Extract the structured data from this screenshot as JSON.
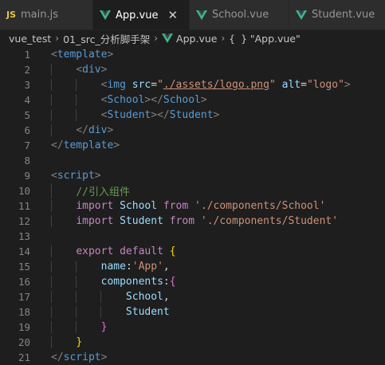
{
  "tabs": [
    {
      "label": "main.js",
      "icon": "js-icon",
      "icon_text": "JS",
      "active": false
    },
    {
      "label": "App.vue",
      "icon": "vue-icon",
      "active": true,
      "close": "✕"
    },
    {
      "label": "School.vue",
      "icon": "vue-icon",
      "active": false
    },
    {
      "label": "Student.vue",
      "icon": "vue-icon",
      "active": false
    }
  ],
  "breadcrumb": {
    "project": "vue_test",
    "folder": "01_src_分析脚手架",
    "file": "App.vue",
    "symbol_icon": "{ }",
    "symbol": "\"App.vue\""
  },
  "colors": {
    "editor_bg": "#1e1e1e",
    "tab_bg": "#2d2d2d",
    "vue_green": "#41b883",
    "js_yellow": "#e8c44a"
  },
  "code": {
    "line_numbers": [
      "1",
      "2",
      "3",
      "4",
      "5",
      "6",
      "7",
      "8",
      "9",
      "10",
      "11",
      "12",
      "13",
      "14",
      "15",
      "16",
      "17",
      "18",
      "19",
      "20",
      "21"
    ],
    "l1": {
      "open": "<",
      "tag": "template",
      "close": ">"
    },
    "l2": {
      "open": "<",
      "tag": "div",
      "close": ">"
    },
    "l3": {
      "open": "<",
      "tag": "img",
      "attr1": "src",
      "eq": "=",
      "q1": "\"",
      "val1": "./assets/logo.png",
      "attr2": "alt",
      "val2": "\"logo\"",
      "close": ">"
    },
    "l4": {
      "open": "<",
      "tag": "School",
      "mid": "></",
      "tag2": "School",
      "close": ">"
    },
    "l5": {
      "open": "<",
      "tag": "Student",
      "mid": "></",
      "tag2": "Student",
      "close": ">"
    },
    "l6": {
      "open": "</",
      "tag": "div",
      "close": ">"
    },
    "l7": {
      "open": "</",
      "tag": "template",
      "close": ">"
    },
    "l9": {
      "open": "<",
      "tag": "script",
      "close": ">"
    },
    "l10": {
      "comment": "//引入组件"
    },
    "l11": {
      "kw": "import",
      "name": "School",
      "from": "from",
      "path": "'./components/School'"
    },
    "l12": {
      "kw": "import",
      "name": "Student",
      "from": "from",
      "path": "'./components/Student'"
    },
    "l14": {
      "kw": "export",
      "kw2": "default",
      "brace": "{"
    },
    "l15": {
      "key": "name",
      "colon": ":",
      "val": "'App'",
      "comma": ","
    },
    "l16": {
      "key": "components",
      "colon": ":",
      "brace": "{"
    },
    "l17": {
      "item": "School",
      "comma": ","
    },
    "l18": {
      "item": "Student"
    },
    "l19": {
      "brace": "}"
    },
    "l20": {
      "brace": "}"
    },
    "l21": {
      "open": "</",
      "tag": "script",
      "close": ">"
    }
  }
}
